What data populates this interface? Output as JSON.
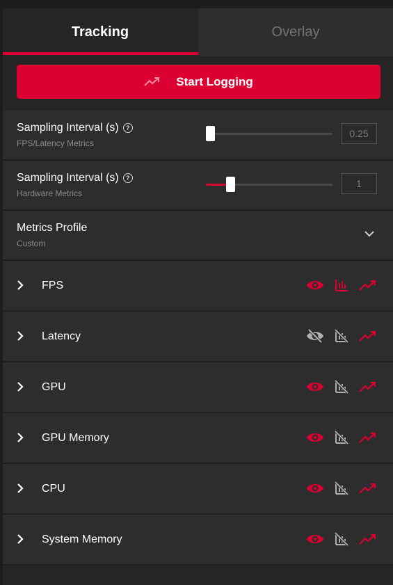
{
  "tabs": [
    {
      "label": "Tracking",
      "active": true
    },
    {
      "label": "Overlay",
      "active": false
    }
  ],
  "start_button": {
    "label": "Start Logging",
    "icon": "trending-up-icon"
  },
  "settings": [
    {
      "title": "Sampling Interval (s)",
      "subtitle": "FPS/Latency Metrics",
      "value": "0.25",
      "slider_fraction": 0.0
    },
    {
      "title": "Sampling Interval (s)",
      "subtitle": "Hardware Metrics",
      "value": "1",
      "slider_fraction": 0.17
    }
  ],
  "profile": {
    "title": "Metrics Profile",
    "value": "Custom"
  },
  "metrics": [
    {
      "name": "FPS",
      "visible": true,
      "chart": true,
      "logging": true
    },
    {
      "name": "Latency",
      "visible": false,
      "chart": false,
      "logging": true
    },
    {
      "name": "GPU",
      "visible": true,
      "chart": false,
      "logging": true
    },
    {
      "name": "GPU Memory",
      "visible": true,
      "chart": false,
      "logging": true
    },
    {
      "name": "CPU",
      "visible": true,
      "chart": false,
      "logging": true
    },
    {
      "name": "System Memory",
      "visible": true,
      "chart": false,
      "logging": true
    }
  ],
  "colors": {
    "accent": "#dc0032",
    "inactive_icon": "#b0b0b0",
    "panel": "#2d2d2d",
    "background": "#1c1c1c"
  }
}
